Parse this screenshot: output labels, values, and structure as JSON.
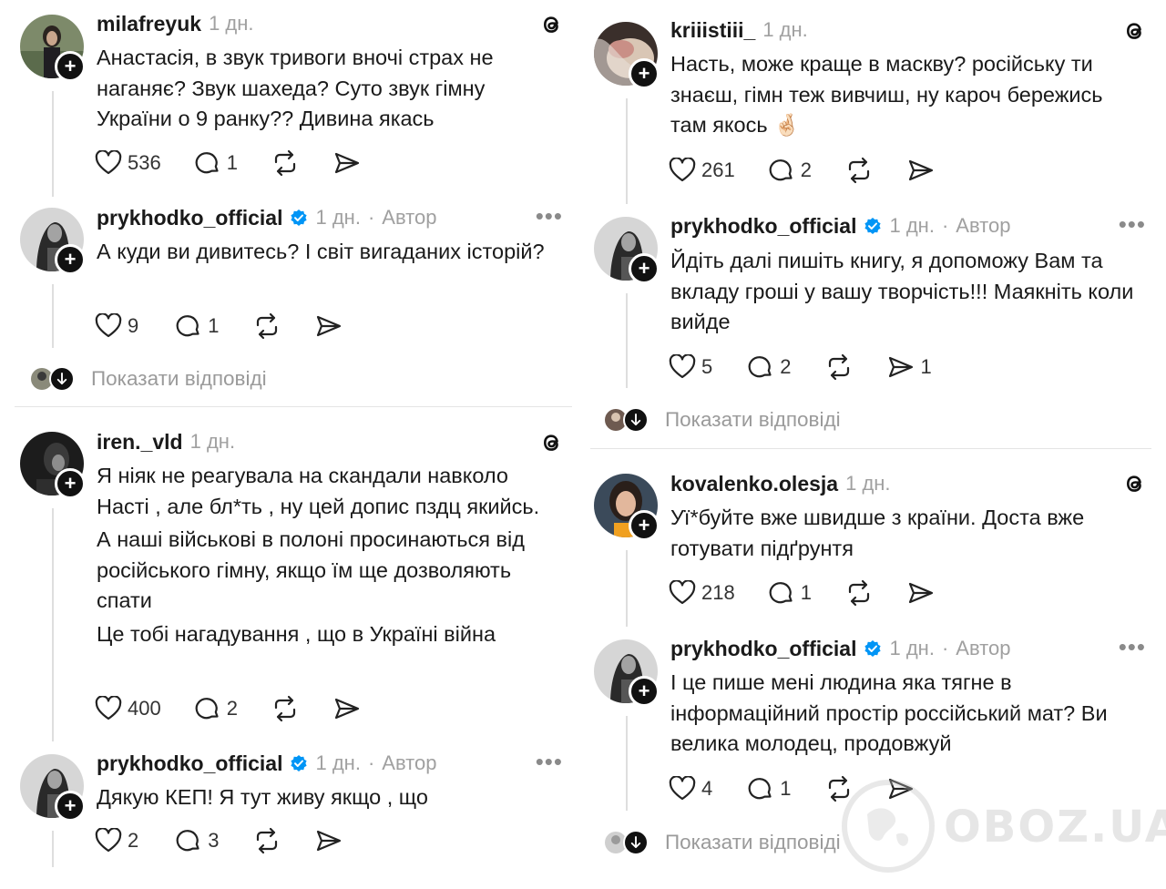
{
  "left": {
    "posts": [
      {
        "username": "milafreyuk",
        "time": "1 дн.",
        "lines": [
          "Анастасія, в звук тривоги вночі страх не наганяє? Звук шахеда? Суто звук гімну України о 9 ранку?? Дивина якась"
        ],
        "likes": "536",
        "replies": "1",
        "shares": ""
      },
      {
        "username": "prykhodko_official",
        "time": "1 дн.",
        "author": "Автор",
        "lines": [
          "А куди ви дивитесь? І світ вигаданих історій?"
        ],
        "likes": "9",
        "replies": "1",
        "shares": ""
      },
      {
        "username": "iren._vld",
        "time": "1 дн.",
        "lines": [
          "Я ніяк не реагувала на скандали навколо Насті , але бл*ть , ну цей допис пздц якийсь.",
          "А наші військові в полоні просинаються від російського гімну, якщо їм ще дозволяють спати",
          "Це тобі нагадування , що в Україні війна"
        ],
        "likes": "400",
        "replies": "2",
        "shares": ""
      },
      {
        "username": "prykhodko_official",
        "time": "1 дн.",
        "author": "Автор",
        "lines": [
          "Дякую КЕП! Я тут живу якщо , що"
        ],
        "likes": "2",
        "replies": "3",
        "shares": ""
      }
    ],
    "show_replies": "Показати відповіді"
  },
  "right": {
    "posts": [
      {
        "username": "kriiistiii_",
        "time": "1 дн.",
        "lines": [
          "Насть, може краще в маскву? російську ти знаєш, гімн теж вивчиш, ну кароч бережись там якось 🤞🏻"
        ],
        "likes": "261",
        "replies": "2",
        "shares": ""
      },
      {
        "username": "prykhodko_official",
        "time": "1 дн.",
        "author": "Автор",
        "lines": [
          "Йдіть далі пишіть книгу, я допоможу Вам та вкладу гроші у вашу творчість!!! Маякніть коли вийде"
        ],
        "likes": "5",
        "replies": "2",
        "shares": "1"
      },
      {
        "username": "kovalenko.olesja",
        "time": "1 дн.",
        "lines": [
          "Уї*буйте вже швидше з країни. Доста вже готувати підґрунтя"
        ],
        "likes": "218",
        "replies": "1",
        "shares": ""
      },
      {
        "username": "prykhodko_official",
        "time": "1 дн.",
        "author": "Автор",
        "lines": [
          "І це пише мені людина яка тягне в інформаційний простір россійський мат? Ви велика молодец, продовжуй"
        ],
        "likes": "4",
        "replies": "1",
        "shares": ""
      }
    ],
    "show_replies": "Показати відповіді"
  },
  "watermark": "OBOZ.UA",
  "colors": {
    "verified": "#0095f6",
    "muted": "#a0a0a0",
    "text": "#1a1a1a"
  }
}
